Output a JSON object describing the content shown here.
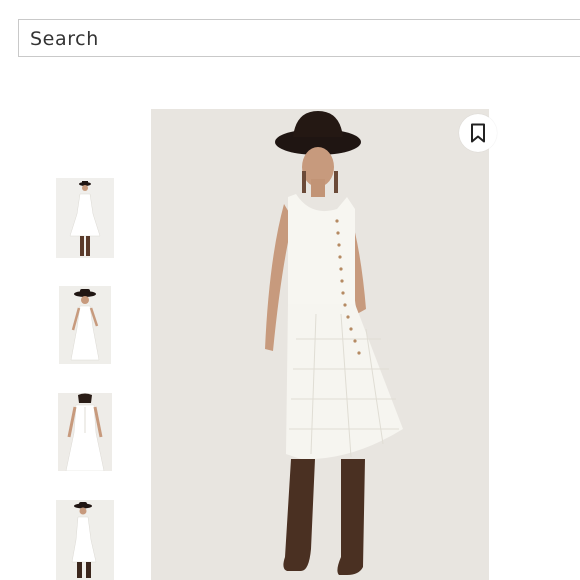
{
  "search": {
    "placeholder": "Search"
  },
  "product": {
    "thumbnails": [
      {
        "icon": "product-thumbnail"
      },
      {
        "icon": "product-thumbnail"
      },
      {
        "icon": "product-thumbnail"
      },
      {
        "icon": "product-thumbnail"
      }
    ],
    "main_image": {
      "icon": "product-main-image"
    },
    "save_icon": "bookmark-icon"
  },
  "colors": {
    "border": "#c9c9c9",
    "photo_bg": "#e7e4df",
    "dress": "#f7f6f1",
    "hat": "#1f1512",
    "boots": "#4a3022",
    "skin": "#c79a7d"
  }
}
